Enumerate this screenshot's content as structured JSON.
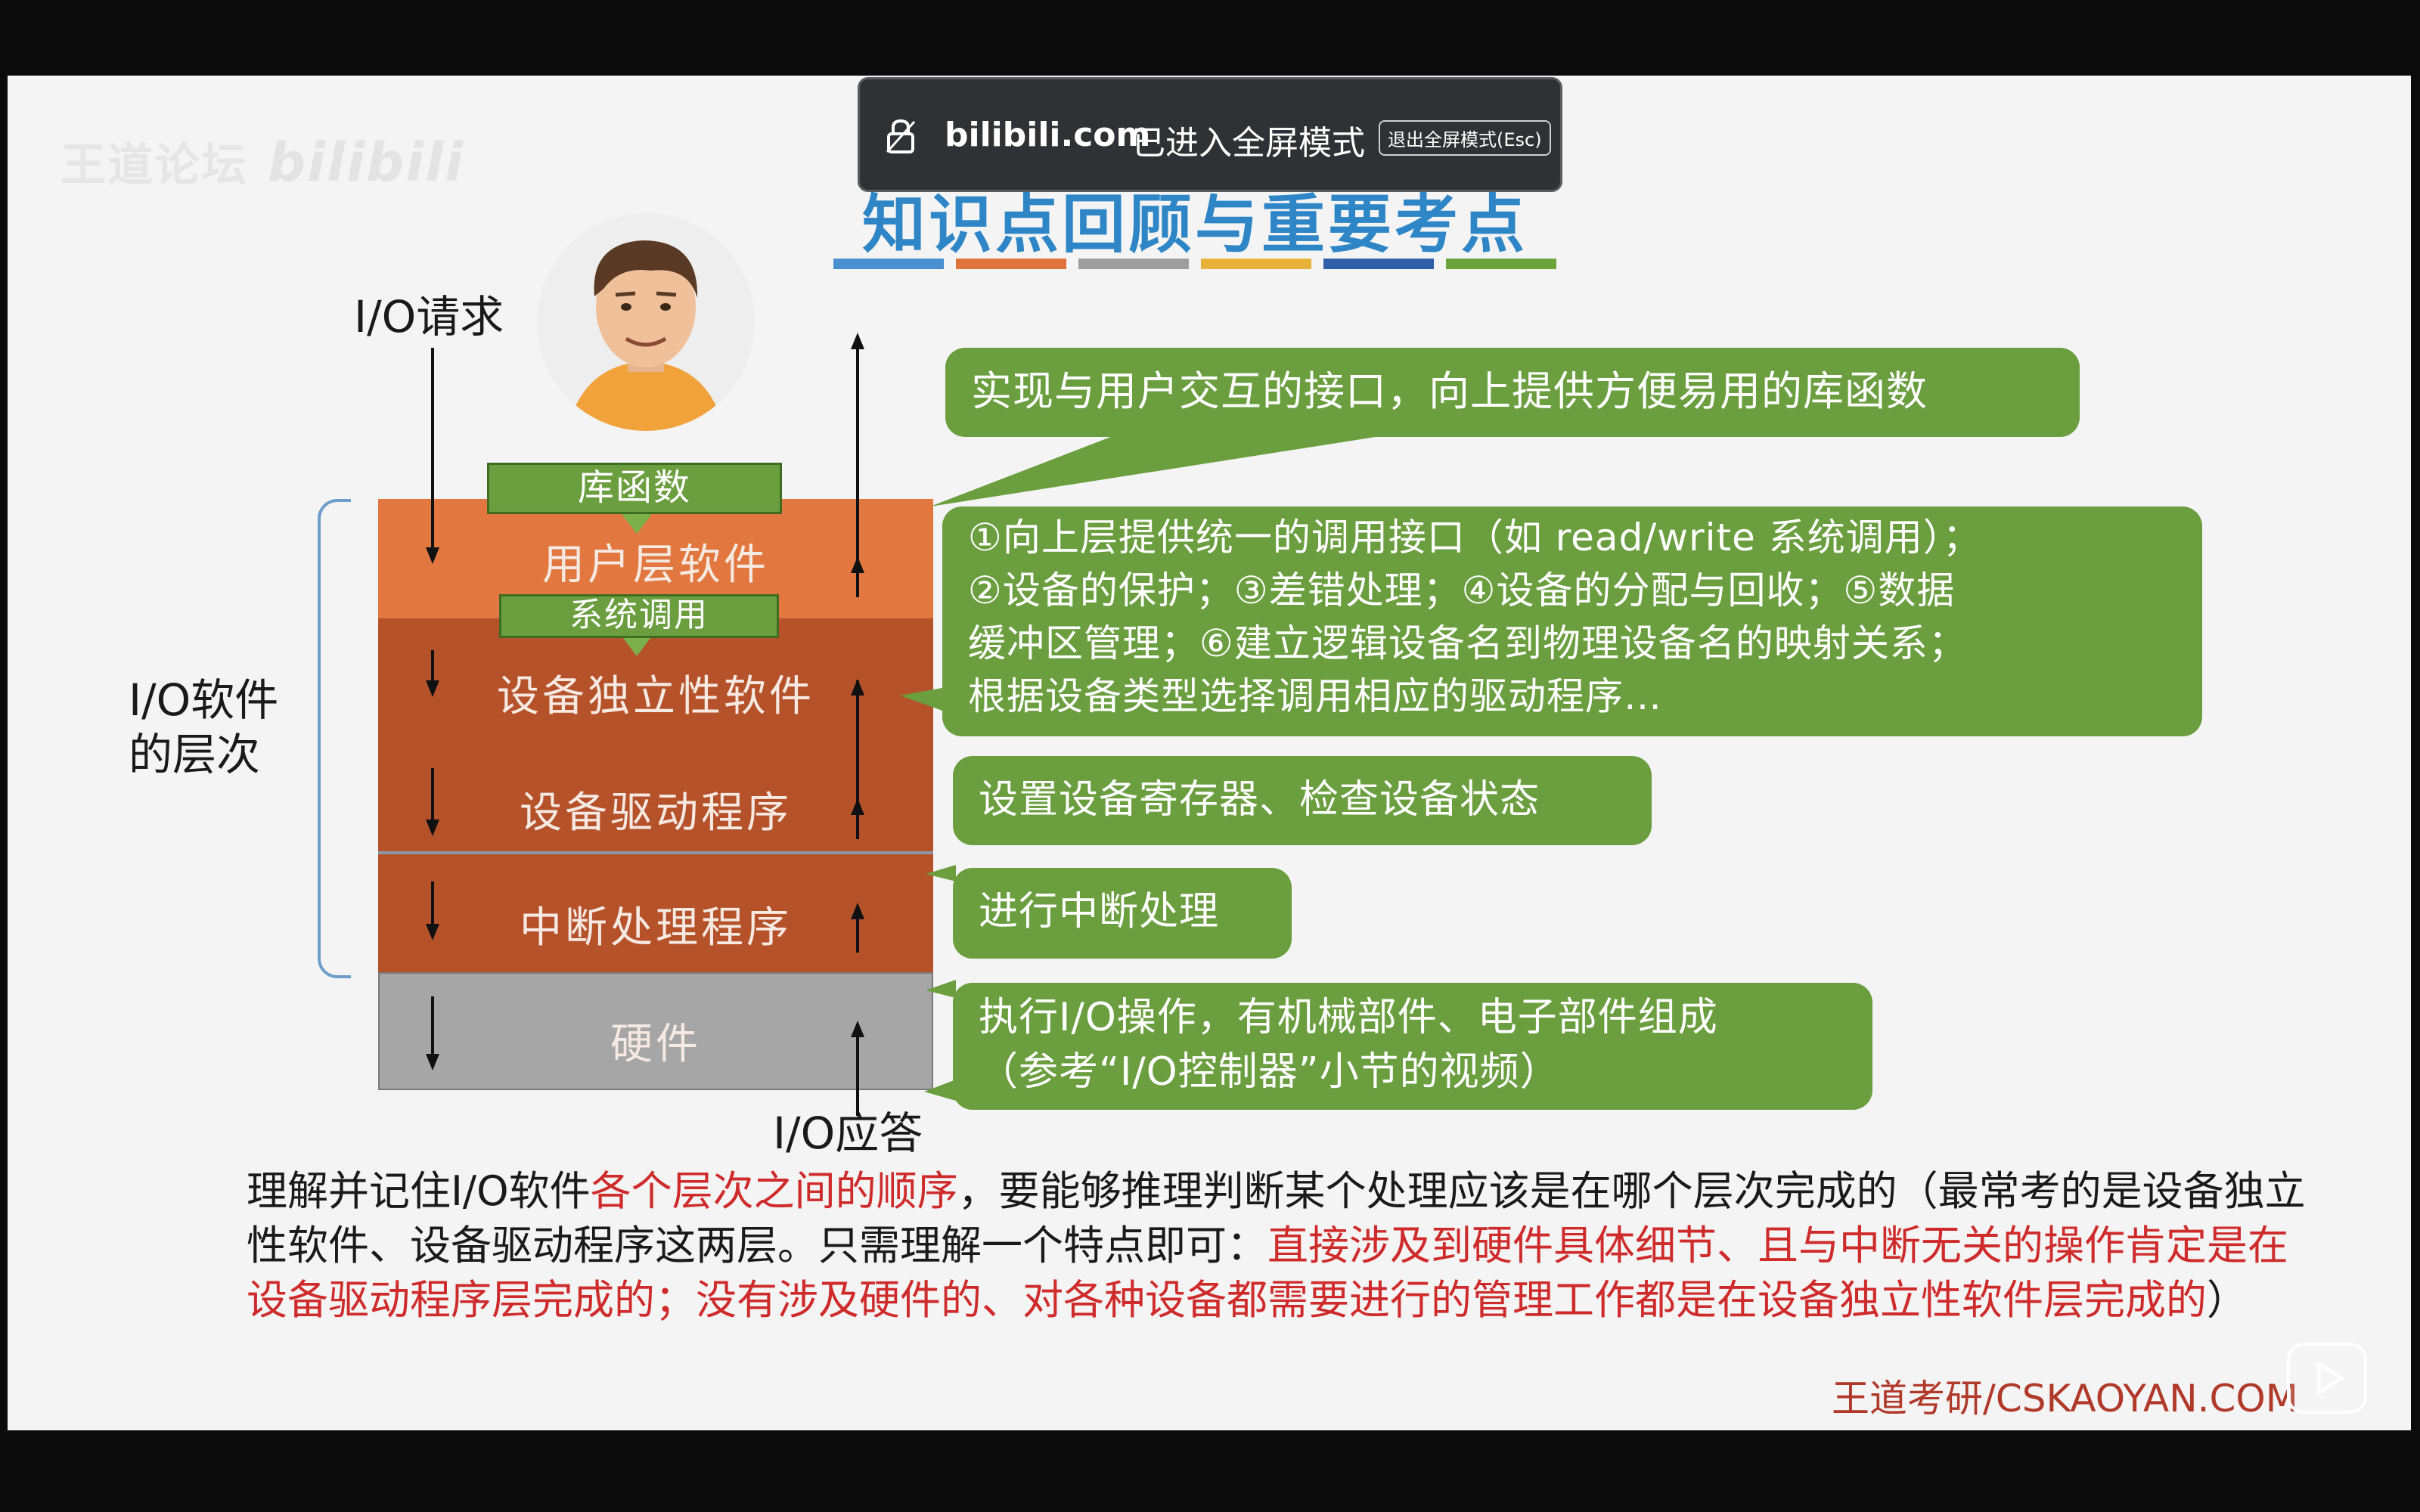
{
  "watermark": {
    "brand": "王道论坛",
    "logo": "bilibili"
  },
  "fullscreen_toast": {
    "site": "bilibili.com",
    "message": "已进入全屏模式",
    "exit_label": "退出全屏模式(Esc)"
  },
  "slide": {
    "title": "知识点回顾与重要考点",
    "title_bar_colors": [
      "#4a90d0",
      "#e0733c",
      "#9e9e9e",
      "#e8b23a",
      "#2f5fa8",
      "#6aa43a"
    ],
    "io_request_label": "I/O请求",
    "io_response_label": "I/O应答",
    "io_software_label_line1": "I/O软件",
    "io_software_label_line2": "的层次",
    "library_label": "库函数",
    "syscall_label": "系统调用",
    "layers": [
      {
        "name": "用户层软件",
        "color": "#e2773f"
      },
      {
        "name": "设备独立性软件",
        "color": "#b5522a"
      },
      {
        "name": "设备驱动程序",
        "color": "#b5522a"
      },
      {
        "name": "中断处理程序",
        "color": "#b5522a"
      },
      {
        "name": "硬件",
        "color": "#a6a6a6"
      }
    ],
    "callouts": {
      "user_layer": "实现与用户交互的接口，向上提供方便易用的库函数",
      "device_independent_lines": [
        "①向上层提供统一的调用接口（如 read/write 系统调用）；",
        "②设备的保护；③差错处理；④设备的分配与回收；⑤数据",
        "缓冲区管理；⑥建立逻辑设备名到物理设备名的映射关系；",
        "根据设备类型选择调用相应的驱动程序…"
      ],
      "driver": "设置设备寄存器、检查设备状态",
      "interrupt": "进行中断处理",
      "hardware_line1": "执行I/O操作，有机械部件、电子部件组成",
      "hardware_line2": "（参考“I/O控制器”小节的视频）"
    },
    "summary": {
      "part1": "理解并记住I/O软件",
      "part2_red": "各个层次之间的顺序",
      "part3": "，要能够推理判断某个处理应该是在哪个层次完成的（最常考的是设备独立性软件、设备驱动程序这两层。只需理解一个特点即可：",
      "part4_red": "直接涉及到硬件具体细节、且与中断无关的操作肯定是在设备驱动程序层完成的；没有涉及硬件的、对各种设备都需要进行的管理工作都是在设备独立性软件层完成的",
      "part5": "）"
    },
    "footer_brand": "王道考研/CSKAOYAN.COM"
  },
  "colors": {
    "callout_green": "#6b9e3f",
    "title_blue": "#2e86c7",
    "highlight_red": "#cf2b2b"
  }
}
